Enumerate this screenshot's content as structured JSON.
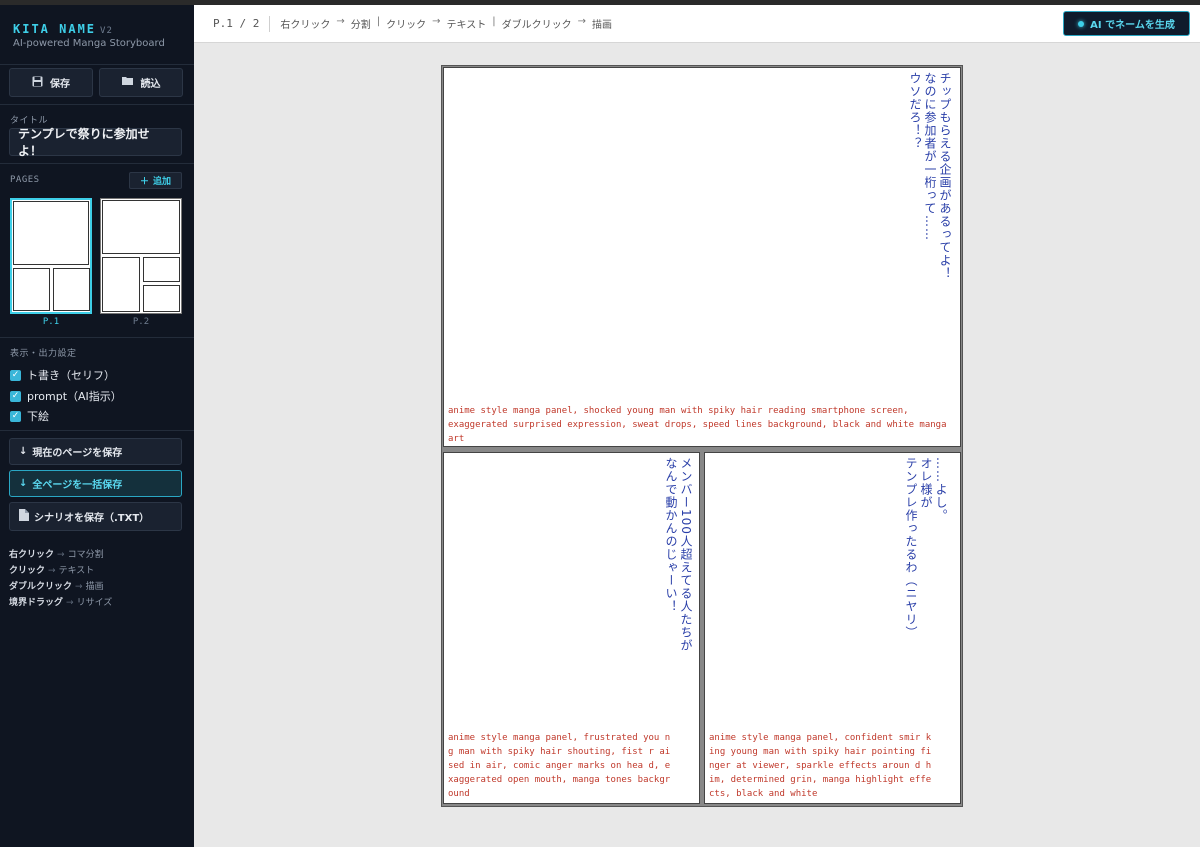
{
  "app": {
    "name": "KITA NAME",
    "version": "V2",
    "subtitle": "AI-powered Manga Storyboard"
  },
  "sidebar": {
    "save_label": "保存",
    "load_label": "読込",
    "title_label": "タイトル",
    "title_value": "テンプレで祭りに参加せよ！",
    "pages_label": "PAGES",
    "add_label": "追加",
    "pages": [
      {
        "label": "P.1",
        "active": true
      },
      {
        "label": "P.2",
        "active": false
      }
    ],
    "display_label": "表示・出力設定",
    "options": [
      {
        "label": "ト書き（セリフ）",
        "checked": true
      },
      {
        "label": "prompt（AI指示）",
        "checked": true
      },
      {
        "label": "下絵",
        "checked": true
      }
    ],
    "export_buttons": [
      {
        "label": "現在のページを保存",
        "icon": "down-arrow-icon"
      },
      {
        "label": "全ページを一括保存",
        "icon": "down-arrow-icon"
      },
      {
        "label": "シナリオを保存（.TXT）",
        "icon": "document-icon"
      }
    ],
    "hints": [
      {
        "key": "右クリック",
        "action": "コマ分割"
      },
      {
        "key": "クリック",
        "action": "テキスト"
      },
      {
        "key": "ダブルクリック",
        "action": "描画"
      },
      {
        "key": "境界ドラッグ",
        "action": "リサイズ"
      }
    ]
  },
  "topbar": {
    "page_indicator": "P.1 / 2",
    "crumbs": [
      "右クリック",
      "分割",
      "|",
      "クリック",
      "テキスト",
      "|",
      "ダブルクリック",
      "描画"
    ],
    "generate_label": "AI でネームを生成"
  },
  "panels": [
    {
      "dialogue": "チップもらえる企画があるってよ！\nなのに参加者が一桁って……\nウソだろ！？",
      "prompt": "anime style manga panel, shocked young man with spiky hair reading smartphone screen, exaggerated surprised expression, sweat drops, speed lines background, black and white manga art"
    },
    {
      "dialogue": "メンバー100人超えてる人たちが\nなんで動かんのじゃーい！",
      "prompt": "anime style manga panel, frustrated you ng man with spiky hair shouting, fist r aised in air, comic anger marks on hea d, exaggerated open mouth, manga tones background"
    },
    {
      "dialogue": "……よし。\nオレ様が\nテンプレ作ったるわ（ニヤリ）",
      "prompt": "anime style manga panel, confident smir king young man with spiky hair pointing finger at viewer, sparkle effects aroun d him, determined grin, manga highlight effects, black and white"
    }
  ],
  "colors": {
    "accent": "#3ecfe8",
    "sidebar_bg": "#0f1521",
    "dialogue": "#2a3fa8",
    "prompt": "#c0392b"
  }
}
